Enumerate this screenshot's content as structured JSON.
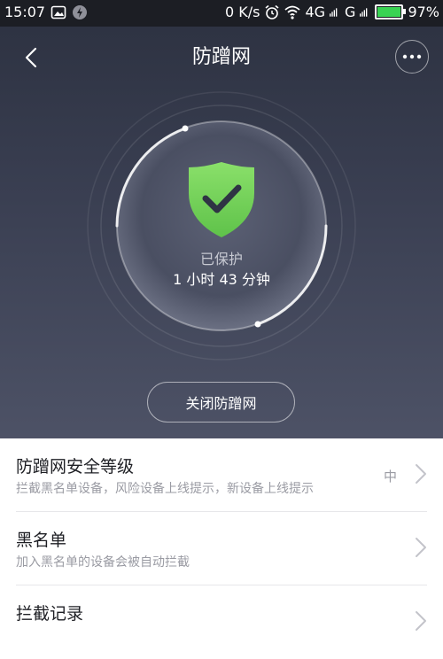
{
  "status_bar": {
    "time": "15:07",
    "network_speed": "0 K/s",
    "signal_1": "4G",
    "signal_2": "G",
    "battery_percent": "97%",
    "battery_level": 0.97,
    "icons": [
      "gallery-icon",
      "charging-bolt-icon",
      "alarm-icon",
      "wifi-icon",
      "signal-icon",
      "battery-icon"
    ]
  },
  "nav": {
    "title": "防蹭网",
    "back_icon": "chevron-left-icon",
    "more_icon": "more-dots-icon"
  },
  "protection": {
    "status": "已保护",
    "duration": "1 小时 43 分钟",
    "shield_icon": "shield-check-icon",
    "shield_color": "#7bd35c",
    "close_button": "关闭防蹭网"
  },
  "settings": [
    {
      "title": "防蹭网安全等级",
      "description": "拦截黑名单设备，风险设备上线提示，新设备上线提示",
      "value": "中"
    },
    {
      "title": "黑名单",
      "description": "加入黑名单的设备会被自动拦截",
      "value": ""
    },
    {
      "title": "拦截记录",
      "description": "",
      "value": ""
    }
  ],
  "colors": {
    "hero_top": "#2c3140",
    "hero_bottom": "#4d5266",
    "accent_green": "#7bd35c",
    "list_bg": "#ffffff"
  }
}
